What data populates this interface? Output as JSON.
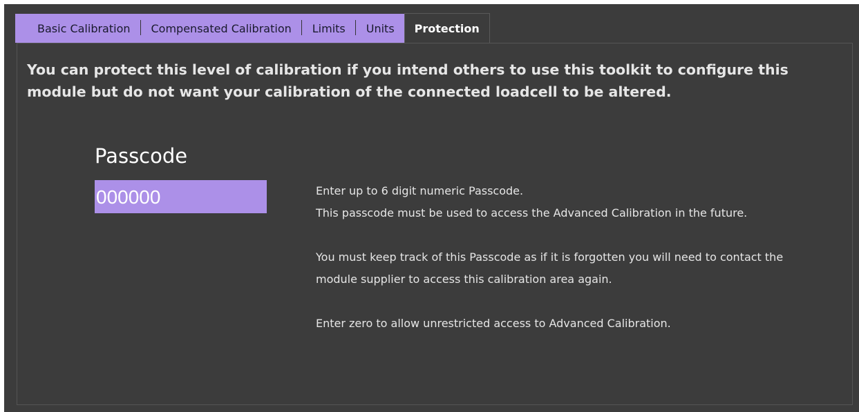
{
  "tabs": [
    {
      "label": "Basic Calibration",
      "active": false
    },
    {
      "label": "Compensated Calibration",
      "active": false
    },
    {
      "label": "Limits",
      "active": false
    },
    {
      "label": "Units",
      "active": false
    },
    {
      "label": "Protection",
      "active": true
    }
  ],
  "panel": {
    "intro": "You can protect this level of calibration if you intend others to use this toolkit to configure this module but do not want your calibration of the connected loadcell to be altered.",
    "passcode_label": "Passcode",
    "passcode_value": "000000",
    "help": {
      "line1": "Enter up to 6 digit numeric Passcode.",
      "line2": "This passcode must be used to access the Advanced Calibration in the future.",
      "line3": "You must keep track of this Passcode as if it is forgotten you will need to contact the module supplier to access this calibration area again.",
      "line4": "Enter zero to allow unrestricted access to Advanced Calibration."
    }
  },
  "colors": {
    "background": "#3c3c3c",
    "tab_accent": "#ac90e8",
    "text": "#e6e6e6"
  }
}
